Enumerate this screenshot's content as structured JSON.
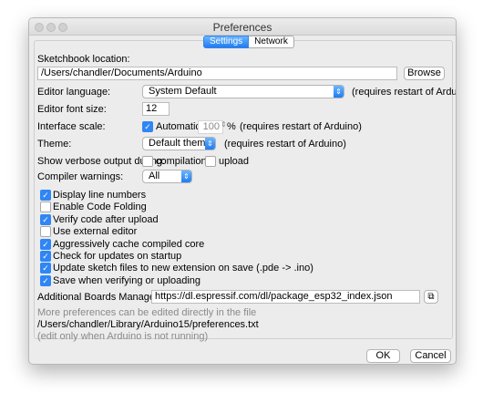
{
  "window": {
    "title": "Preferences"
  },
  "tabs": [
    {
      "label": "Settings",
      "active": true
    },
    {
      "label": "Network",
      "active": false
    }
  ],
  "sketchbook": {
    "label": "Sketchbook location:",
    "path": "/Users/chandler/Documents/Arduino",
    "browse_label": "Browse"
  },
  "editor_language": {
    "label": "Editor language:",
    "value": "System Default",
    "note": "(requires restart of Arduino)"
  },
  "editor_font_size": {
    "label": "Editor font size:",
    "value": "12"
  },
  "interface_scale": {
    "label": "Interface scale:",
    "automatic_label": "Automatic",
    "automatic_checked": true,
    "value": "100",
    "unit": "%",
    "note": "(requires restart of Arduino)"
  },
  "theme": {
    "label": "Theme:",
    "value": "Default theme",
    "note": "(requires restart of Arduino)"
  },
  "verbose": {
    "label": "Show verbose output during:",
    "compilation_label": "compilation",
    "compilation_checked": false,
    "upload_label": "upload",
    "upload_checked": false
  },
  "compiler_warnings": {
    "label": "Compiler warnings:",
    "value": "All"
  },
  "options": [
    {
      "label": "Display line numbers",
      "checked": true
    },
    {
      "label": "Enable Code Folding",
      "checked": false
    },
    {
      "label": "Verify code after upload",
      "checked": true
    },
    {
      "label": "Use external editor",
      "checked": false
    },
    {
      "label": "Aggressively cache compiled core",
      "checked": true
    },
    {
      "label": "Check for updates on startup",
      "checked": true
    },
    {
      "label": "Update sketch files to new extension on save (.pde -> .ino)",
      "checked": true
    },
    {
      "label": "Save when verifying or uploading",
      "checked": true
    }
  ],
  "boards_manager": {
    "label": "Additional Boards Manager URLs:",
    "value": "https://dl.espressif.com/dl/package_esp32_index.json"
  },
  "prefs_file": {
    "hint": "More preferences can be edited directly in the file",
    "path": "/Users/chandler/Library/Arduino15/preferences.txt",
    "note": "(edit only when Arduino is not running)"
  },
  "footer": {
    "ok_label": "OK",
    "cancel_label": "Cancel"
  },
  "colors": {
    "accent": "#2f86f4",
    "window_bg": "#ececec"
  }
}
